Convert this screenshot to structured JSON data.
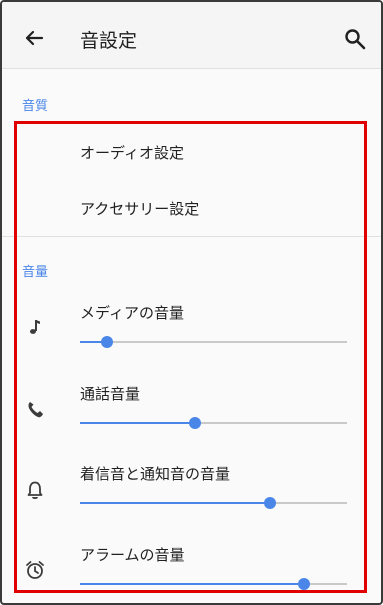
{
  "appbar": {
    "title": "音設定",
    "back_icon": "arrow-left-icon",
    "search_icon": "search-icon"
  },
  "sections": [
    {
      "header": "音質",
      "items": [
        {
          "label": "オーディオ設定"
        },
        {
          "label": "アクセサリー設定"
        }
      ]
    },
    {
      "header": "音量",
      "volumes": [
        {
          "label": "メディアの音量",
          "icon": "music-note-icon",
          "level": 0.1
        },
        {
          "label": "通話音量",
          "icon": "phone-icon",
          "level": 0.43
        },
        {
          "label": "着信音と通知音の音量",
          "icon": "bell-icon",
          "level": 0.71
        },
        {
          "label": "アラームの音量",
          "icon": "alarm-clock-icon",
          "level": 0.84
        }
      ]
    }
  ],
  "colors": {
    "accent": "#4a86e8",
    "highlight_border": "#e00000",
    "track": "#c9c9c9"
  }
}
